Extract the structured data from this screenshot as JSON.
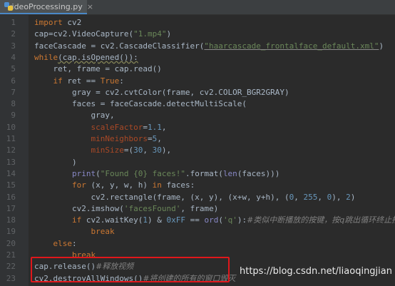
{
  "tab": {
    "label": "videoProcessing.py",
    "close": "×"
  },
  "lines": [
    {
      "n": "1",
      "p": [
        {
          "t": "import cv2",
          "c": "kw0"
        }
      ]
    },
    {
      "n": "2",
      "p": [
        {
          "t": "cap=cv2.VideoCapture(",
          "c": ""
        },
        {
          "t": "\"1.mp4\"",
          "c": "st"
        },
        {
          "t": ")",
          "c": ""
        }
      ]
    },
    {
      "n": "3",
      "p": [
        {
          "t": "faceCascade = cv2.CascadeClassifier(",
          "c": ""
        },
        {
          "t": "\"haarcascade_frontalface_default.xml\"",
          "c": "st ul"
        },
        {
          "t": ")",
          "c": ""
        }
      ]
    },
    {
      "n": "4",
      "p": [
        {
          "t": "while",
          "c": "kw"
        },
        {
          "t": "(cap.isOpened()):",
          "c": "wav"
        }
      ]
    },
    {
      "n": "5",
      "p": [
        {
          "t": "    ret, frame = cap.read()",
          "c": ""
        }
      ]
    },
    {
      "n": "6",
      "p": [
        {
          "t": "    ",
          "c": ""
        },
        {
          "t": "if",
          "c": "kw"
        },
        {
          "t": " ret == ",
          "c": ""
        },
        {
          "t": "True",
          "c": "kw"
        },
        {
          "t": ":",
          "c": ""
        }
      ]
    },
    {
      "n": "7",
      "p": [
        {
          "t": "        gray = cv2.cvtColor(frame, cv2.COLOR_BGR2GRAY)",
          "c": ""
        }
      ]
    },
    {
      "n": "8",
      "p": [
        {
          "t": "        faces = faceCascade.detectMultiScale(",
          "c": ""
        }
      ]
    },
    {
      "n": "9",
      "p": [
        {
          "t": "            gray,",
          "c": ""
        }
      ]
    },
    {
      "n": "10",
      "p": [
        {
          "t": "            ",
          "c": ""
        },
        {
          "t": "scaleFactor",
          "c": "pm"
        },
        {
          "t": "=",
          "c": ""
        },
        {
          "t": "1.1",
          "c": "nm"
        },
        {
          "t": ",",
          "c": ""
        }
      ]
    },
    {
      "n": "11",
      "p": [
        {
          "t": "            ",
          "c": ""
        },
        {
          "t": "minNeighbors",
          "c": "pm"
        },
        {
          "t": "=",
          "c": ""
        },
        {
          "t": "5",
          "c": "nm"
        },
        {
          "t": ",",
          "c": ""
        }
      ]
    },
    {
      "n": "12",
      "p": [
        {
          "t": "            ",
          "c": ""
        },
        {
          "t": "minSize",
          "c": "pm"
        },
        {
          "t": "=(",
          "c": ""
        },
        {
          "t": "30",
          "c": "nm"
        },
        {
          "t": ", ",
          "c": ""
        },
        {
          "t": "30",
          "c": "nm"
        },
        {
          "t": "),",
          "c": ""
        }
      ]
    },
    {
      "n": "13",
      "p": [
        {
          "t": "        )",
          "c": ""
        }
      ]
    },
    {
      "n": "14",
      "p": [
        {
          "t": "        ",
          "c": ""
        },
        {
          "t": "print",
          "c": "bi"
        },
        {
          "t": "(",
          "c": ""
        },
        {
          "t": "\"Found {0} faces!\"",
          "c": "st"
        },
        {
          "t": ".format(",
          "c": ""
        },
        {
          "t": "len",
          "c": "bi"
        },
        {
          "t": "(faces)))",
          "c": ""
        }
      ]
    },
    {
      "n": "15",
      "p": [
        {
          "t": "        ",
          "c": ""
        },
        {
          "t": "for",
          "c": "kw"
        },
        {
          "t": " (x, y, w, h) ",
          "c": ""
        },
        {
          "t": "in",
          "c": "kw"
        },
        {
          "t": " faces:",
          "c": ""
        }
      ]
    },
    {
      "n": "16",
      "p": [
        {
          "t": "            cv2.rectangle(frame, (x, y), (x+w, y+h), (",
          "c": ""
        },
        {
          "t": "0",
          "c": "nm"
        },
        {
          "t": ", ",
          "c": ""
        },
        {
          "t": "255",
          "c": "nm"
        },
        {
          "t": ", ",
          "c": ""
        },
        {
          "t": "0",
          "c": "nm"
        },
        {
          "t": "), ",
          "c": ""
        },
        {
          "t": "2",
          "c": "nm"
        },
        {
          "t": ")",
          "c": ""
        }
      ]
    },
    {
      "n": "17",
      "p": [
        {
          "t": "        cv2.imshow(",
          "c": ""
        },
        {
          "t": "'facesFound'",
          "c": "st"
        },
        {
          "t": ", frame)",
          "c": ""
        }
      ]
    },
    {
      "n": "18",
      "p": [
        {
          "t": "        ",
          "c": ""
        },
        {
          "t": "if",
          "c": "kw"
        },
        {
          "t": " cv2.waitKey(",
          "c": ""
        },
        {
          "t": "1",
          "c": "nm"
        },
        {
          "t": ") & ",
          "c": ""
        },
        {
          "t": "0xFF",
          "c": "nm"
        },
        {
          "t": " == ",
          "c": ""
        },
        {
          "t": "ord",
          "c": "bi"
        },
        {
          "t": "(",
          "c": ""
        },
        {
          "t": "'q'",
          "c": "st"
        },
        {
          "t": "):",
          "c": ""
        },
        {
          "t": "#类似中断播放的按键，按q跳出循环终止播放",
          "c": "cm"
        }
      ]
    },
    {
      "n": "19",
      "p": [
        {
          "t": "            ",
          "c": ""
        },
        {
          "t": "break",
          "c": "kw"
        }
      ]
    },
    {
      "n": "20",
      "p": [
        {
          "t": "    ",
          "c": ""
        },
        {
          "t": "else",
          "c": "kw"
        },
        {
          "t": ":",
          "c": ""
        }
      ]
    },
    {
      "n": "21",
      "p": [
        {
          "t": "        ",
          "c": ""
        },
        {
          "t": "break",
          "c": "kw"
        }
      ]
    },
    {
      "n": "22",
      "p": [
        {
          "t": "cap.release()",
          "c": ""
        },
        {
          "t": "#释放视频",
          "c": "cm"
        }
      ]
    },
    {
      "n": "23",
      "p": [
        {
          "t": "cv2.destroyAllWindows()",
          "c": ""
        },
        {
          "t": "#将创建的所有的窗口毁灭",
          "c": "cm"
        }
      ]
    }
  ],
  "watermark": "https://blog.csdn.net/liaoqingjian",
  "colors": {
    "keyword": "#cc7832",
    "string": "#6a8759",
    "number": "#6897bb",
    "param": "#aa4926",
    "comment": "#808080",
    "highlight_box": "#e0171b"
  }
}
